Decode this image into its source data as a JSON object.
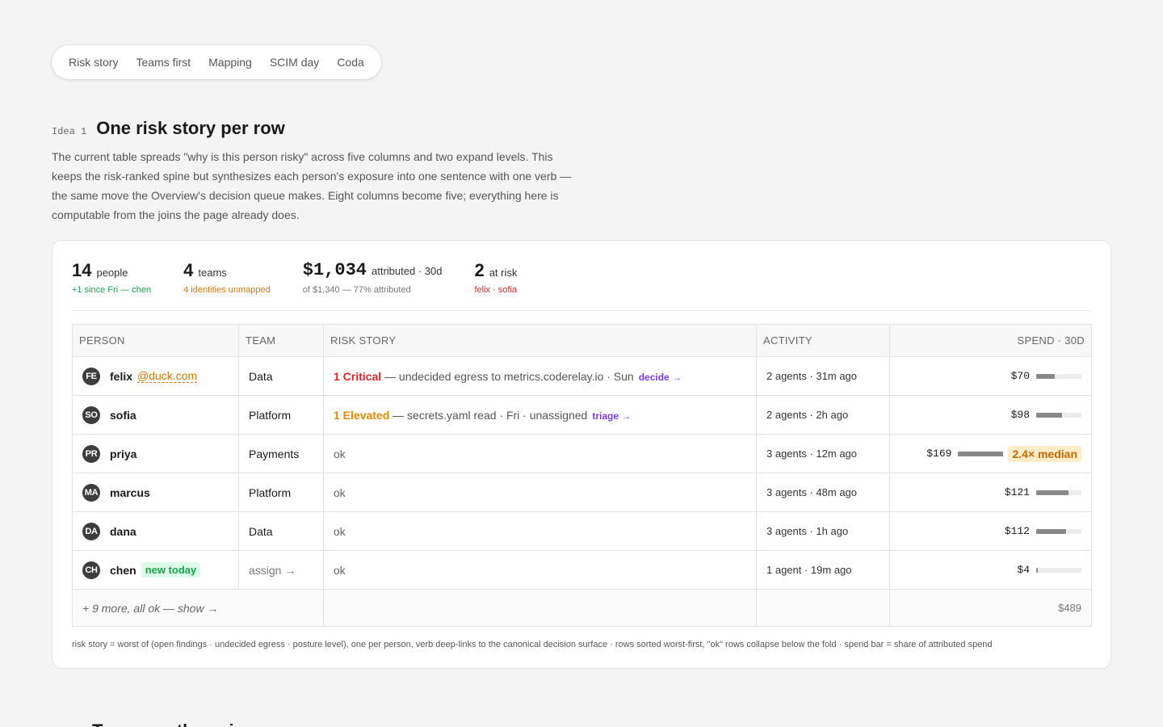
{
  "tabs": [
    "Risk story",
    "Teams first",
    "Mapping",
    "SCIM day",
    "Coda"
  ],
  "section": {
    "tag": "Idea 1",
    "title": "One risk story per row",
    "description": "The current table spreads \"why is this person risky\" across five columns and two expand levels. This keeps the risk-ranked spine but synthesizes each person's exposure into one sentence with one verb — the same move the Overview's decision queue makes. Eight columns become five; everything here is computable from the joins the page already does."
  },
  "stats": [
    {
      "num": "14",
      "unit": "people",
      "sub": "+1 since Fri — chen",
      "sub_color": "green"
    },
    {
      "num": "4",
      "unit": "teams",
      "sub": "4 identities unmapped",
      "sub_color": "orange"
    },
    {
      "num": "$1,034",
      "unit": "attributed · 30d",
      "sub": "of $1,340 — 77% attributed",
      "sub_color": "gray",
      "mono": true
    },
    {
      "num": "2",
      "unit": "at risk",
      "sub": "felix · sofia",
      "sub_color": "red"
    }
  ],
  "table": {
    "headers": [
      "PERSON",
      "TEAM",
      "RISK STORY",
      "ACTIVITY",
      "SPEND · 30D"
    ],
    "rows": [
      {
        "initials": "FE",
        "name": "felix",
        "domain": "@duck.com",
        "team": "Data",
        "severity": "1 Critical",
        "severity_kind": "critical",
        "story": " — undecided egress to metrics.coderelay.io · Sun",
        "verb": "decide →",
        "activity": "2 agents · 31m ago",
        "spend": "$70",
        "spend_share": 0.41
      },
      {
        "initials": "SO",
        "name": "sofia",
        "team": "Platform",
        "severity": "1 Elevated",
        "severity_kind": "elevated",
        "story": " — secrets.yaml read · Fri · unassigned",
        "verb": "triage →",
        "activity": "2 agents · 2h ago",
        "spend": "$98",
        "spend_share": 0.58
      },
      {
        "initials": "PR",
        "name": "priya",
        "team": "Payments",
        "story_ok": "ok",
        "activity": "3 agents · 12m ago",
        "spend": "$169",
        "spend_share": 1.0,
        "median": "2.4× median"
      },
      {
        "initials": "MA",
        "name": "marcus",
        "team": "Platform",
        "story_ok": "ok",
        "activity": "3 agents · 48m ago",
        "spend": "$121",
        "spend_share": 0.72
      },
      {
        "initials": "DA",
        "name": "dana",
        "team": "Data",
        "story_ok": "ok",
        "activity": "3 agents · 1h ago",
        "spend": "$112",
        "spend_share": 0.66
      },
      {
        "initials": "CH",
        "name": "chen",
        "badge": "new today",
        "team_assign": "assign →",
        "story_ok": "ok",
        "activity": "1 agent · 19m ago",
        "spend": "$4",
        "spend_share": 0.03
      }
    ],
    "footer": {
      "more": "+ 9 more, all ok — show →",
      "total": "$489"
    }
  },
  "footnote": "risk story = worst of (open findings · undecided egress · posture level), one per person, verb deep-links to the canonical decision surface · rows sorted worst-first, \"ok\" rows collapse below the fold · spend bar = share of attributed spend",
  "next_section_title": "Teams as the spine",
  "colors": {
    "critical": "#dc2626",
    "elevated": "#e08a00",
    "verb": "#7c3aed",
    "positive": "#16a34a"
  }
}
